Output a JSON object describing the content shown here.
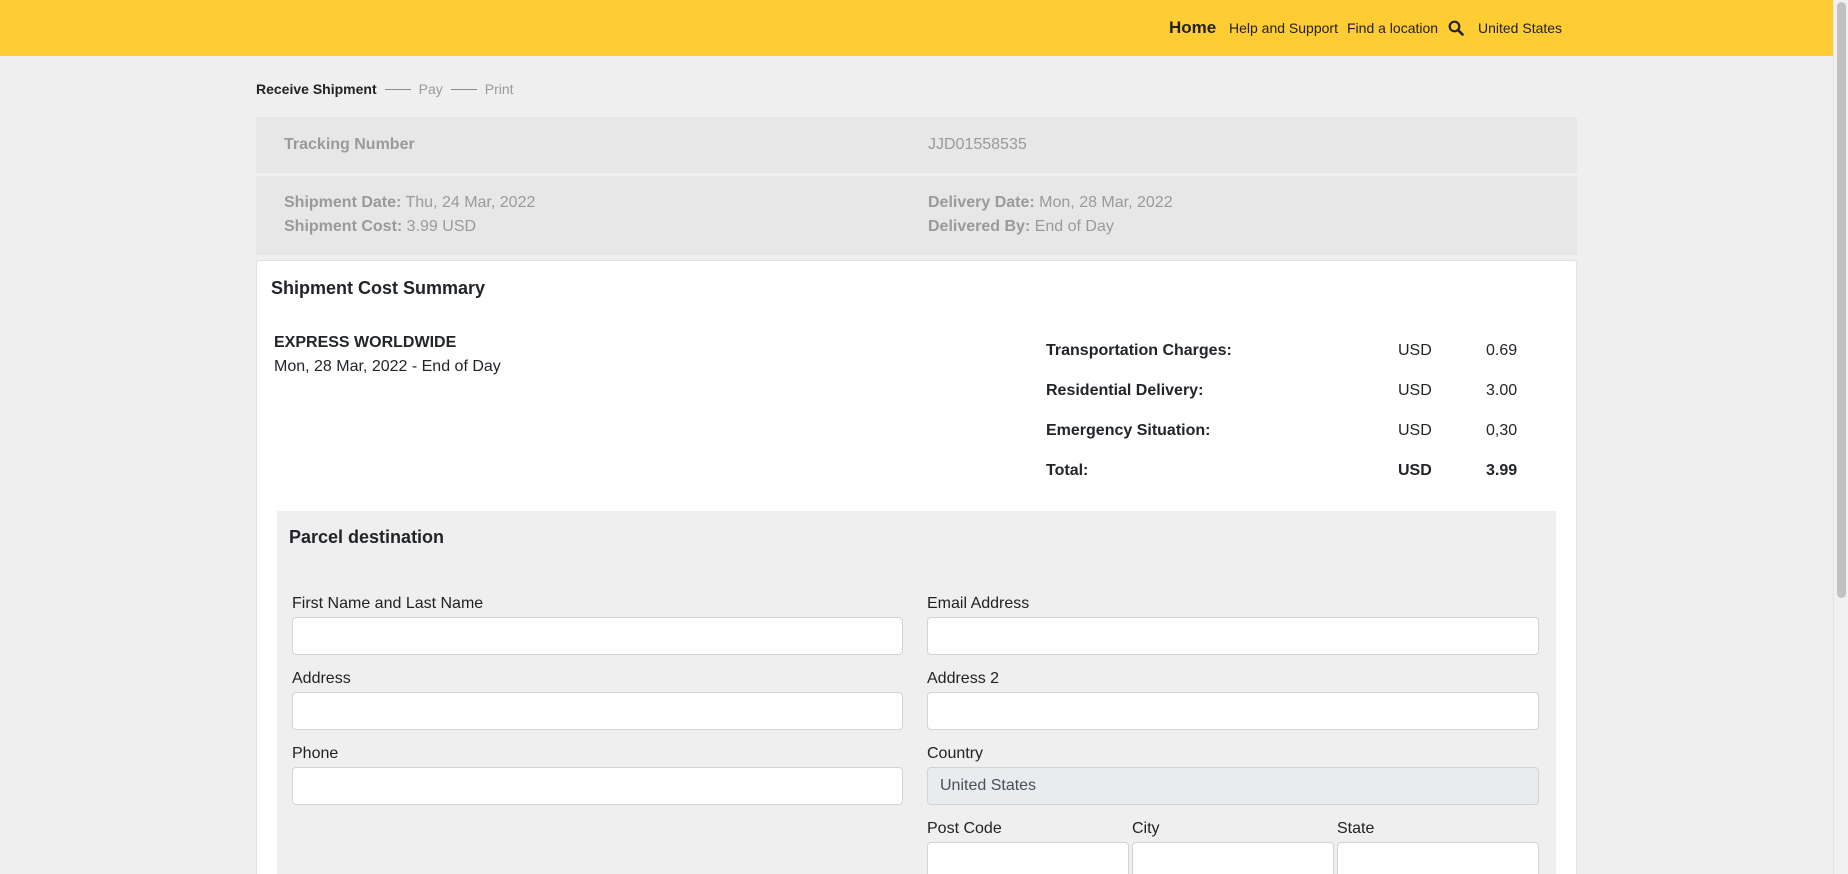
{
  "header": {
    "home": "Home",
    "help": "Help and Support",
    "find_location": "Find a location",
    "search_icon": "search-icon",
    "country": "United States",
    "color": "#ffcc33"
  },
  "steps": {
    "receive": "Receive Shipment",
    "pay": "Pay",
    "print": "Print"
  },
  "tracking": {
    "label": "Tracking Number",
    "value": "JJD01558535"
  },
  "shipment": {
    "date_label": "Shipment Date:",
    "date_value": "Thu, 24 Mar, 2022",
    "cost_label": "Shipment Cost:",
    "cost_value": "3.99 USD",
    "delivery_label": "Delivery Date:",
    "delivery_value": "Mon, 28 Mar, 2022",
    "by_label": "Delivered By:",
    "by_value": "End of Day"
  },
  "summary": {
    "title": "Shipment Cost Summary",
    "service": "EXPRESS WORLDWIDE",
    "service_date": "Mon, 28 Mar, 2022 - End of Day",
    "rows": [
      {
        "label": "Transportation Charges:",
        "currency": "USD",
        "value": "0.69"
      },
      {
        "label": "Residential Delivery:",
        "currency": "USD",
        "value": "3.00"
      },
      {
        "label": "Emergency Situation:",
        "currency": "USD",
        "value": "0,30"
      },
      {
        "label": "Total:",
        "currency": "USD",
        "value": "3.99"
      }
    ]
  },
  "destination": {
    "title": "Parcel destination",
    "name_label": "First Name and Last Name",
    "name_value": "",
    "email_label": "Email Address",
    "email_value": "",
    "address_label": "Address",
    "address_value": "",
    "address2_label": "Address 2",
    "address2_value": "",
    "phone_label": "Phone",
    "phone_value": "",
    "country_label": "Country",
    "country_value": "United States",
    "postcode_label": "Post Code",
    "postcode_value": "",
    "city_label": "City",
    "city_value": "",
    "state_label": "State",
    "state_value": ""
  }
}
